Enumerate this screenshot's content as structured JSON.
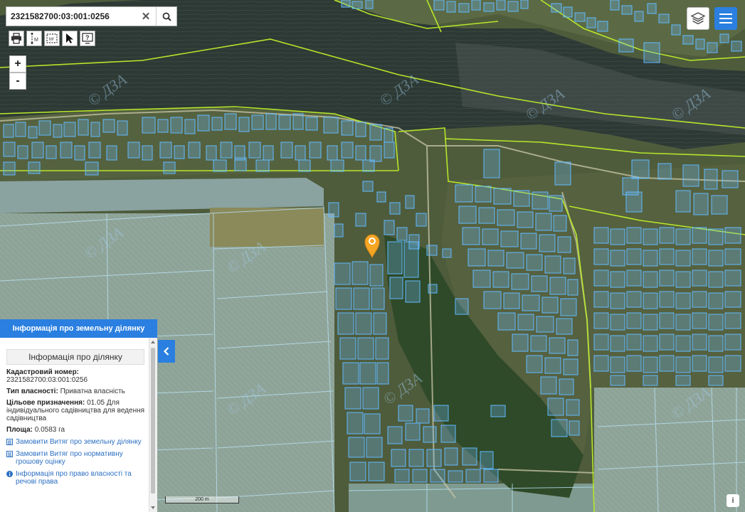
{
  "search": {
    "value": "2321582700:03:001:0256"
  },
  "icons": {
    "clear": "close-icon",
    "search": "search-icon",
    "print": "printer-icon",
    "measure_line": "ruler-icon",
    "measure_area": "area-icon",
    "select": "pointer-icon",
    "help": "help-icon",
    "layers": "layers-icon",
    "menu": "hamburger-icon",
    "collapse": "chevron-left-icon",
    "info": "info-icon",
    "marker": "map-marker-icon"
  },
  "tools": {
    "measure_line_label": "M",
    "measure_area_label": "M²"
  },
  "zoom": {
    "in_label": "+",
    "out_label": "-"
  },
  "map": {
    "watermark": "© ДЗА",
    "scale_label": "200 m"
  },
  "panel": {
    "title": "Інформація про земельну ділянку",
    "subtitle": "Інформація про ділянку",
    "cadastral_label": "Кадастровий номер:",
    "cadastral_value": "2321582700:03:001:0256",
    "ownership_label": "Тип власності:",
    "ownership_value": "Приватна власність",
    "purpose_label": "Цільове призначення:",
    "purpose_value": "01.05 Для індивідуального садівництва для ведення садівництва",
    "area_label": "Площа:",
    "area_value": "0.0583 га",
    "links": [
      "Замовити Витяг про земельну ділянку",
      "Замовити Витяг про нормативну грошову оцінку",
      "Інформація про право власності та речові права"
    ]
  },
  "info_button": {
    "label": "i"
  },
  "colors": {
    "accent": "#2a7fe0",
    "parcel": "#5fb8ff",
    "boundary": "#b8e62a",
    "marker": "#f5a623",
    "water": "#2e3a33",
    "field": "#8aa197",
    "forest": "#34502c",
    "settlement": "#5d6b45"
  }
}
